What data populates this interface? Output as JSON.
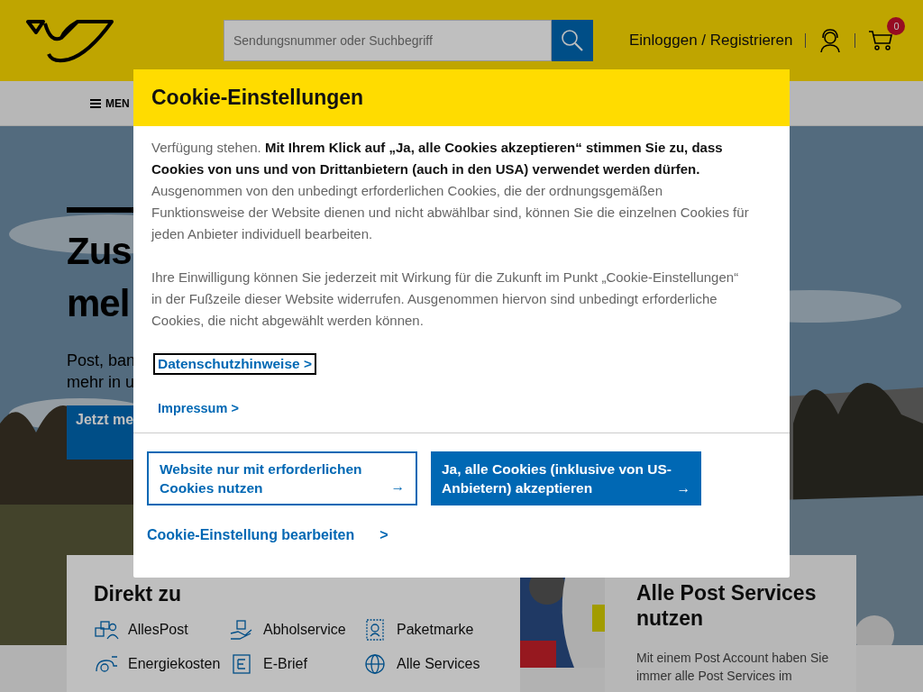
{
  "header": {
    "search": {
      "placeholder": "Sendungsnummer oder Suchbegriff"
    },
    "login": "Einloggen / Registrieren",
    "cart_count": "0"
  },
  "nav": {
    "menu": "MEN"
  },
  "hero": {
    "title_lines": [
      "Zus",
      "mel"
    ],
    "text_lines": [
      "Post, ban",
      "mehr in u"
    ],
    "button": "Jetzt me"
  },
  "direkt": {
    "title": "Direkt zu",
    "items": [
      "AllesPost",
      "Abholservice",
      "Paketmarke",
      "Energiekosten",
      "E-Brief",
      "Alle Services"
    ]
  },
  "services": {
    "title": "Alle Post Services nutzen",
    "text_lines": [
      "Mit einem Post Account haben Sie",
      "immer alle Post Services im"
    ]
  },
  "dialog": {
    "title": "Cookie-Einstellungen",
    "paragraphs": [
      "Verfügung stehen. **Mit Ihrem Klick auf „Ja, alle Cookies akzeptieren“ stimmen Sie zu, dass Cookies von uns und von Drittanbietern (auch in den USA) verwendet werden dürfen.** Ausgenommen von den unbedingt erforderlichen Cookies, die der ordnungsgemäßen Funktionsweise der Website dienen und nicht abwählbar sind, können Sie die einzelnen Cookies für jeden Anbieter individuell bearbeiten.",
      "Ihre Einwilligung können Sie jederzeit mit Wirkung für die Zukunft im Punkt „Cookie-Einstellungen“ in der Fußzeile dieser Website widerrufen. Ausgenommen hiervon sind unbedingt erforderliche Cookies, die nicht abgewählt werden können."
    ],
    "links": [
      {
        "label": "Datenschutzhinweise",
        "arrow": ">",
        "focused": true
      },
      {
        "label": "Impressum",
        "arrow": ">",
        "focused": false
      }
    ],
    "buttons": [
      {
        "label": "Website nur mit erforderlichen Cookies nutzen",
        "arrow": "→",
        "kind": "outline"
      },
      {
        "label": "Ja, alle Cookies (inklusive von US-Anbietern) akzeptieren",
        "arrow": "→",
        "kind": "primary"
      }
    ],
    "edit_link": {
      "label": "Cookie-Einstellung bearbeiten",
      "arrow": ">"
    }
  }
}
